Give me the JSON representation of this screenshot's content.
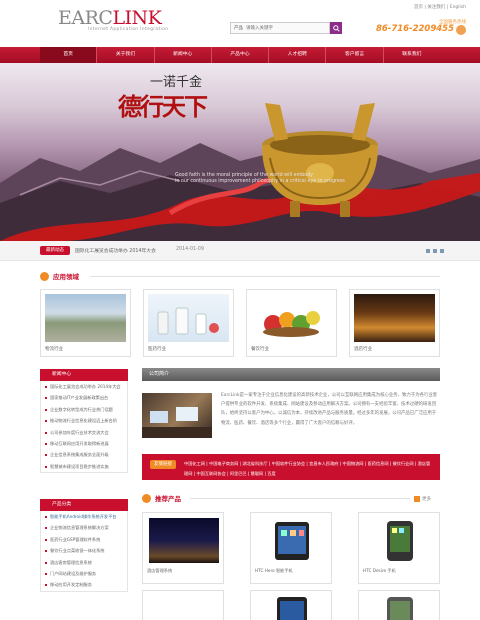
{
  "header": {
    "logo_prefix": "EARC",
    "logo_suffix": "LINK",
    "logo_tagline": "Internet Application Integration",
    "top_links": "首页 | 关注我们 | English",
    "search_label": "产品",
    "search_placeholder": "请输入关键字",
    "hotline_label": "全国服务热线",
    "hotline": "86-716-2209455"
  },
  "nav": {
    "items": [
      "首页",
      "关于我们",
      "新闻中心",
      "产品中心",
      "人才招聘",
      "客户留言",
      "联系我们"
    ],
    "active_index": 0
  },
  "banner": {
    "calligraphy_small": "一诺千金",
    "calligraphy_large": "德行天下",
    "caption_line1": "Good faith is the moral principle of the world will embody",
    "caption_line2": "in our continuous improvement philosophy in a critical eye to progress"
  },
  "ticker": {
    "badge": "最新动态",
    "text": "国际化工展览会成功举办 2014年大会",
    "date": "2014-01-09"
  },
  "applications": {
    "title": "应用领域",
    "items": [
      {
        "label": "物流行业"
      },
      {
        "label": "医药行业"
      },
      {
        "label": "餐饮行业"
      },
      {
        "label": "酒店行业"
      }
    ]
  },
  "sidebar": {
    "news_title": "新闻中心",
    "news_items": [
      "国际化工展览会成功举办 2014年大会",
      "国家推动IT产业发展新政策出台",
      "企业数字化转型成为行业热门话题",
      "推动物流行业信息化建设迈上新台阶",
      "公司参加年度行业技术交流大会",
      "移动互联网应用开发取得新进展",
      "企业信息系统集成服务全面升级",
      "智慧城市建设项目稳步推进实施"
    ],
    "products_title": "产品分类",
    "product_items": [
      "智能手机Android操作系统开发平台",
      "企业物流信息管理系统解决方案",
      "医药行业GSP管理软件系统",
      "餐饮行业点菜收银一体化系统",
      "酒店客房管理信息系统",
      "门户网站建设及维护服务",
      "移动应用开发定制服务"
    ]
  },
  "intro": {
    "title": "公司简介",
    "text": "EarcLink是一家专注于企业信息化建设的高新技术企业，公司以互联网应用集成为核心业务，致力于为各行业客户提供专业的软件开发、系统集成、网站建设及移动应用解决方案。公司拥有一支经验丰富、技术过硬的研发团队，始终坚持以客户为中心，以诚信为本，持续改进产品与服务质量。经过多年的发展，公司产品已广泛应用于物流、医药、餐饮、酒店等多个行业，赢得了广大客户的信赖与好评。"
  },
  "links": {
    "badge": "友情链接",
    "text": "中国化工网 | 中国电子商务网 | 湖北省科技厅 | 中国软件行业协会 | 宜昌市人民政府 | 中国物流网 | 医药信息网 | 餐饮行业网 | 酒店管理网 | 中国互联网协会 | 阿里巴巴 | 慧聪网 | 百度"
  },
  "products": {
    "title": "推荐产品",
    "more": "更多",
    "items": [
      {
        "label": "酒店管理系统"
      },
      {
        "label": "HTC Hero 智能手机"
      },
      {
        "label": "HTC Desire 手机"
      }
    ]
  },
  "colors": {
    "brand_red": "#c8102e",
    "accent_orange": "#f08a24",
    "search_purple": "#8e2c8e"
  }
}
